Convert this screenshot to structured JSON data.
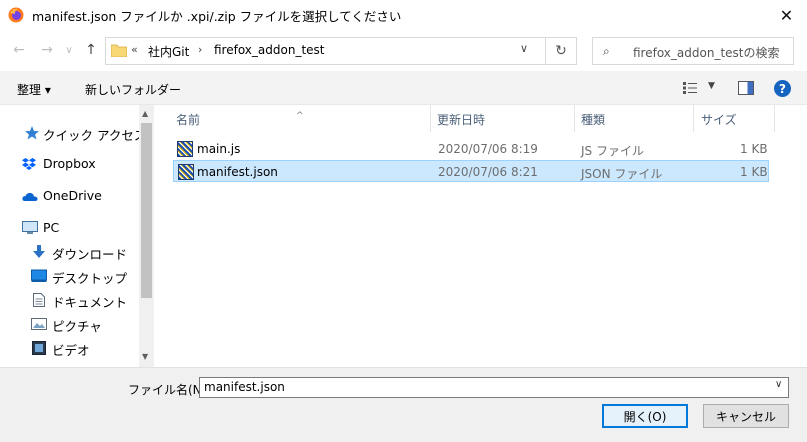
{
  "window": {
    "title": "manifest.json ファイルか .xpi/.zip ファイルを選択してください",
    "close_glyph": "✕"
  },
  "nav": {
    "back_glyph": "←",
    "forward_glyph": "→",
    "recent_glyph": "∨",
    "up_glyph": "↑",
    "address_prefix": "«",
    "path": [
      "社内Git",
      "firefox_addon_test"
    ],
    "path_sep": "›",
    "address_dropdown_glyph": "∨",
    "refresh_glyph": "↻",
    "search_glyph": "⌕",
    "search_placeholder": "firefox_addon_testの検索"
  },
  "toolbar": {
    "organize": "整理 ▾",
    "new_folder": "新しいフォルダー",
    "help": "?",
    "view_dropdown_glyph": "▼"
  },
  "sidebar": {
    "items": [
      {
        "label": "クイック アクセス",
        "icon": "star-icon"
      },
      {
        "label": "Dropbox",
        "icon": "dropbox-icon"
      },
      {
        "label": "OneDrive",
        "icon": "cloud-icon"
      },
      {
        "label": "PC",
        "icon": "pc-icon"
      },
      {
        "label": "ダウンロード",
        "icon": "download-icon"
      },
      {
        "label": "デスクトップ",
        "icon": "desktop-icon"
      },
      {
        "label": "ドキュメント",
        "icon": "document-icon"
      },
      {
        "label": "ピクチャ",
        "icon": "picture-icon"
      },
      {
        "label": "ビデオ",
        "icon": "video-icon"
      }
    ],
    "scroll_up_glyph": "▲",
    "scroll_down_glyph": "▼"
  },
  "columns": {
    "name": "名前",
    "date": "更新日時",
    "type": "種類",
    "size": "サイズ",
    "sort_glyph": "^"
  },
  "files": [
    {
      "name": "main.js",
      "date": "2020/07/06 8:19",
      "type": "JS ファイル",
      "size": "1 KB",
      "selected": false
    },
    {
      "name": "manifest.json",
      "date": "2020/07/06 8:21",
      "type": "JSON ファイル",
      "size": "1 KB",
      "selected": true
    }
  ],
  "footer": {
    "filename_label": "ファイル名(N):",
    "filename_value": "manifest.json",
    "filename_dropdown_glyph": "∨",
    "open": "開く(O)",
    "cancel": "キャンセル"
  },
  "colors": {
    "selection_bg": "#cce8ff",
    "selection_border": "#99d1ff",
    "accent": "#0078d7"
  }
}
